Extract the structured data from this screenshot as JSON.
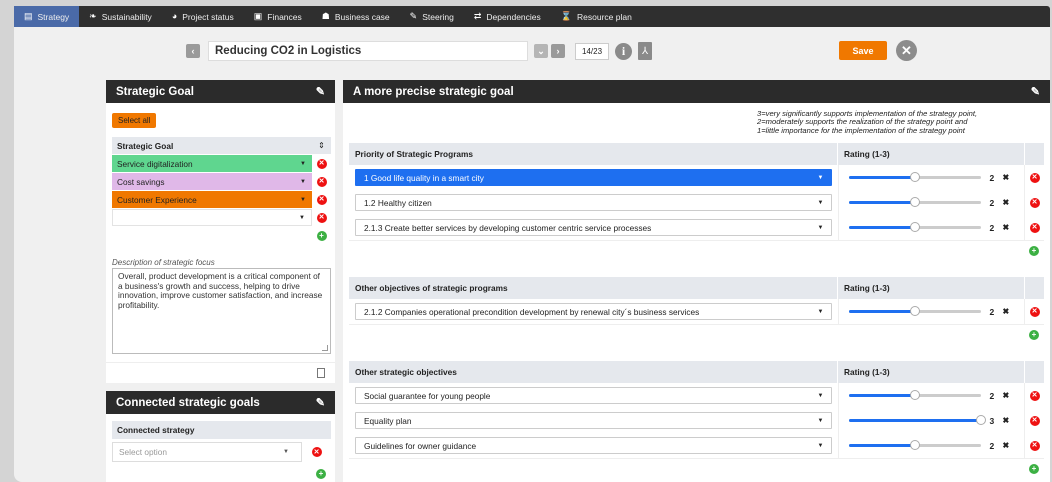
{
  "nav": {
    "items": [
      {
        "label": "Strategy",
        "icon": "list-icon",
        "glyph": "▤",
        "active": true
      },
      {
        "label": "Sustainability",
        "icon": "leaf-icon",
        "glyph": "❧"
      },
      {
        "label": "Project status",
        "icon": "gauge-icon",
        "glyph": "◕"
      },
      {
        "label": "Finances",
        "icon": "money-icon",
        "glyph": "▣"
      },
      {
        "label": "Business case",
        "icon": "briefcase-icon",
        "glyph": "☗"
      },
      {
        "label": "Steering",
        "icon": "steering-icon",
        "glyph": "✎"
      },
      {
        "label": "Dependencies",
        "icon": "arrows-icon",
        "glyph": "⇄"
      },
      {
        "label": "Resource plan",
        "icon": "hourglass-icon",
        "glyph": "⌛"
      }
    ]
  },
  "header": {
    "title": "Reducing CO2 in Logistics",
    "counter": "14/23",
    "save_label": "Save",
    "prev_glyph": "‹",
    "next_glyph": "›",
    "dropdown_glyph": "⌄",
    "info_glyph": "i",
    "pdf_glyph": "⅄",
    "close_glyph": "✕"
  },
  "strategic_goal": {
    "title": "Strategic Goal",
    "select_all": "Select all",
    "column_header": "Strategic Goal",
    "rows": [
      {
        "label": "Service digitalization",
        "color": "#5fd68f"
      },
      {
        "label": "Cost savings",
        "color": "#e0b8e8"
      },
      {
        "label": "Customer Experience",
        "color": "#f07800"
      },
      {
        "label": "",
        "color": "#ffffff"
      }
    ],
    "description_label": "Description of strategic focus",
    "description": "Overall, product development is a critical component of a business's growth and success, helping to drive innovation, improve customer satisfaction, and increase profitability."
  },
  "connected": {
    "title": "Connected strategic goals",
    "column_header": "Connected strategy",
    "placeholder": "Select option"
  },
  "precise_goal": {
    "title": "A more precise strategic goal",
    "legend_lines": [
      "3=very significantly supports implementation of the strategy point,",
      "2=moderately supports the realization of the strategy point and",
      "1=little importance for the implementation of the strategy point"
    ],
    "rating_header": "Rating (1-3)",
    "sections": [
      {
        "header": "Priority of Strategic Programs",
        "rows": [
          {
            "label": "1 Good life quality in a smart city",
            "rating": 2,
            "highlight": true
          },
          {
            "label": "1.2 Healthy citizen",
            "rating": 2
          },
          {
            "label": "2.1.3 Create better services by developing customer centric service processes",
            "rating": 2
          }
        ]
      },
      {
        "header": "Other objectives of strategic programs",
        "rows": [
          {
            "label": "2.1.2 Companies operational precondition development by renewal city´s business services",
            "rating": 2
          }
        ]
      },
      {
        "header": "Other strategic objectives",
        "rows": [
          {
            "label": "Social guarantee for young people",
            "rating": 2
          },
          {
            "label": "Equality plan",
            "rating": 3
          },
          {
            "label": "Guidelines for owner guidance",
            "rating": 2
          }
        ]
      }
    ]
  },
  "colors": {
    "accent": "#f07800",
    "active_blue": "#1e6ff0",
    "header_dark": "#2b2b2b"
  }
}
